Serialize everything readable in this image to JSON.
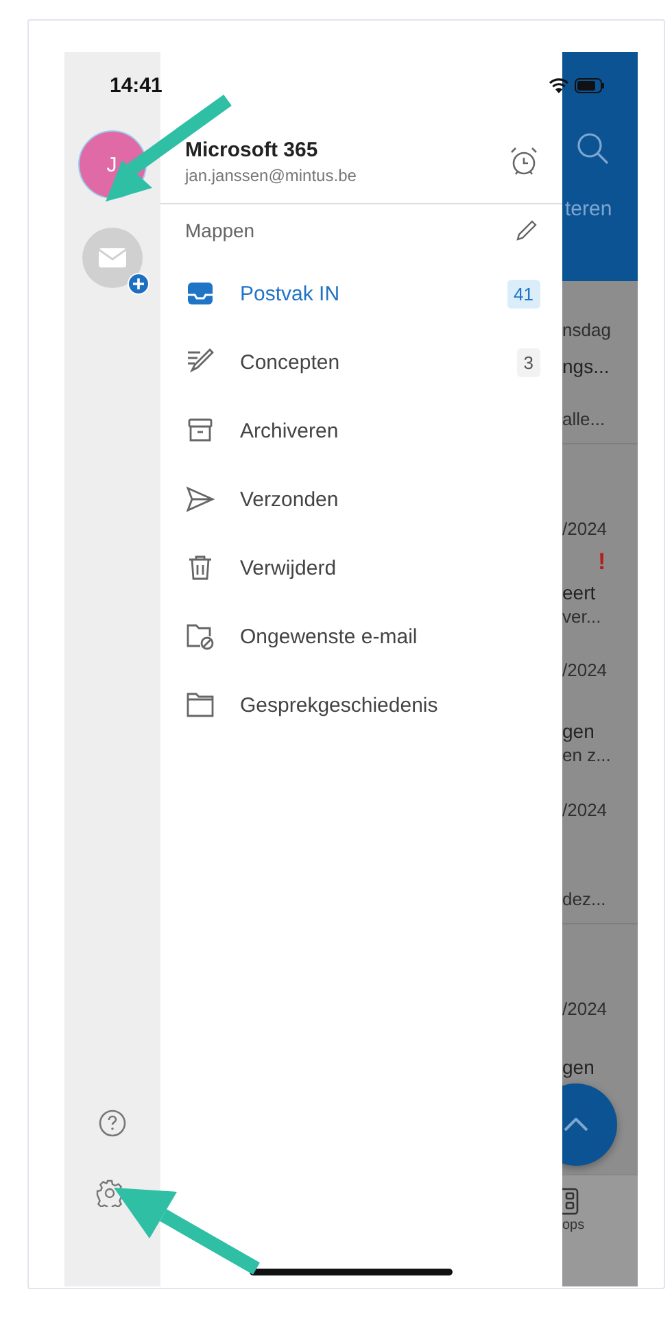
{
  "status_bar": {
    "time": "14:41"
  },
  "rail": {
    "avatar_initial": "J"
  },
  "account": {
    "name": "Microsoft 365",
    "email": "jan.janssen@mintus.be"
  },
  "folders_title": "Mappen",
  "folders": [
    {
      "kind": "inbox",
      "label": "Postvak IN",
      "count": "41",
      "selected": true
    },
    {
      "kind": "drafts",
      "label": "Concepten",
      "count": "3",
      "selected": false
    },
    {
      "kind": "archive",
      "label": "Archiveren",
      "selected": false
    },
    {
      "kind": "sent",
      "label": "Verzonden",
      "selected": false
    },
    {
      "kind": "deleted",
      "label": "Verwijderd",
      "selected": false
    },
    {
      "kind": "junk",
      "label": "Ongewenste e-mail",
      "selected": false
    },
    {
      "kind": "history",
      "label": "Gesprekgeschiedenis",
      "selected": false
    }
  ],
  "background": {
    "header_label": "teren",
    "lines": [
      {
        "kind": "date",
        "text": "nsdag"
      },
      {
        "kind": "subject",
        "text": "ngs..."
      },
      {
        "kind": "preview",
        "text": "alle..."
      },
      {
        "kind": "date",
        "text": "/2024"
      },
      {
        "kind": "flag",
        "text": "!"
      },
      {
        "kind": "subject",
        "text": "eert"
      },
      {
        "kind": "preview",
        "text": "ver..."
      },
      {
        "kind": "date",
        "text": "/2024"
      },
      {
        "kind": "subject",
        "text": "gen"
      },
      {
        "kind": "preview",
        "text": "en z..."
      },
      {
        "kind": "date",
        "text": "/2024"
      },
      {
        "kind": "preview",
        "text": "dez..."
      },
      {
        "kind": "date",
        "text": "/2024"
      },
      {
        "kind": "subject",
        "text": "gen"
      }
    ],
    "tab_label": "ops"
  }
}
